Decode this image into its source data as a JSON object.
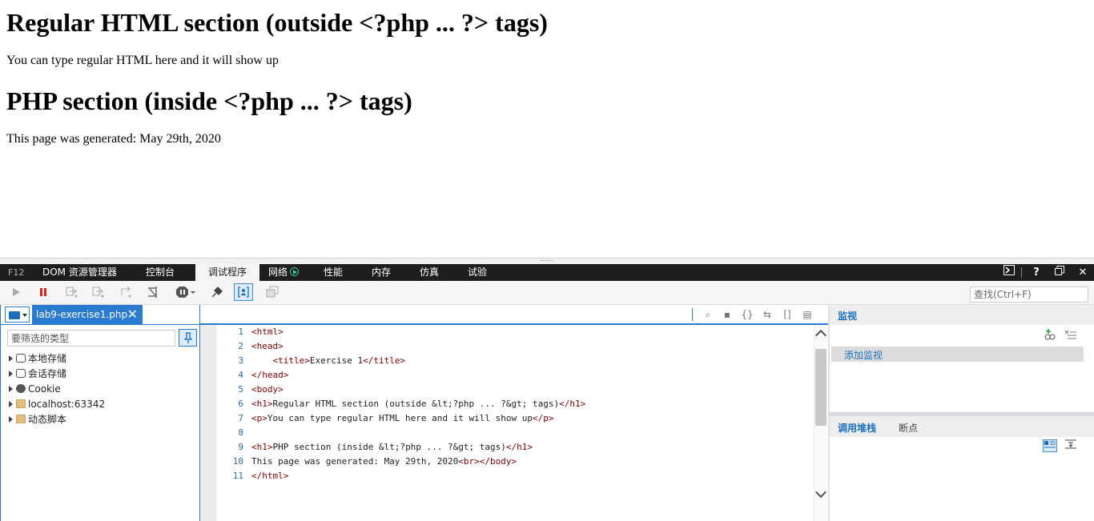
{
  "page": {
    "heading1": "Regular HTML section (outside <?php ... ?> tags)",
    "paragraph1": "You can type regular HTML here and it will show up",
    "heading2": "PHP section (inside <?php ... ?> tags)",
    "paragraph2": "This page was generated: May 29th, 2020"
  },
  "devtools": {
    "f12_label": "F12",
    "tabs": [
      "DOM 资源管理器",
      "控制台",
      "调试程序",
      "网络",
      "性能",
      "内存",
      "仿真",
      "试验"
    ],
    "active_tab": "调试程序",
    "window_buttons": [
      "console-icon",
      "help",
      "restore",
      "close"
    ],
    "help_glyph": "?",
    "close_glyph": "✕",
    "find_placeholder": "查找(Ctrl+F)",
    "filter_placeholder": "要筛选的类型",
    "tree": [
      {
        "label": "本地存储",
        "icon": "database-icon"
      },
      {
        "label": "会话存储",
        "icon": "database-icon"
      },
      {
        "label": "Cookie",
        "icon": "cookie-icon"
      },
      {
        "label": "localhost:63342",
        "icon": "folder-icon"
      },
      {
        "label": "动态脚本",
        "icon": "folder-icon"
      }
    ],
    "file_tab": "lab9-exercise1.php",
    "code_lines": [
      {
        "n": "1",
        "text": "<html>"
      },
      {
        "n": "2",
        "text": "<head>"
      },
      {
        "n": "3",
        "text": "    <title>Exercise 1</title>"
      },
      {
        "n": "4",
        "text": "</head>"
      },
      {
        "n": "5",
        "text": "<body>"
      },
      {
        "n": "6",
        "text": "<h1>Regular HTML section (outside &lt;?php ... ?&gt; tags)</h1>"
      },
      {
        "n": "7",
        "text": "<p>You can type regular HTML here and it will show up</p>"
      },
      {
        "n": "8",
        "text": ""
      },
      {
        "n": "9",
        "text": "<h1>PHP section (inside &lt;?php ... ?&gt; tags)</h1>"
      },
      {
        "n": "10",
        "text": "This page was generated: May 29th, 2020<br></body>"
      },
      {
        "n": "11",
        "text": "</html>"
      }
    ],
    "watch": {
      "title": "监视",
      "add_watch": "添加监视"
    },
    "callstack": {
      "title": "调用堆栈",
      "breakpoints": "断点"
    },
    "colors": {
      "accent": "#2a7bd0",
      "tabbar": "#1e1e1e",
      "tag": "#800000"
    }
  }
}
